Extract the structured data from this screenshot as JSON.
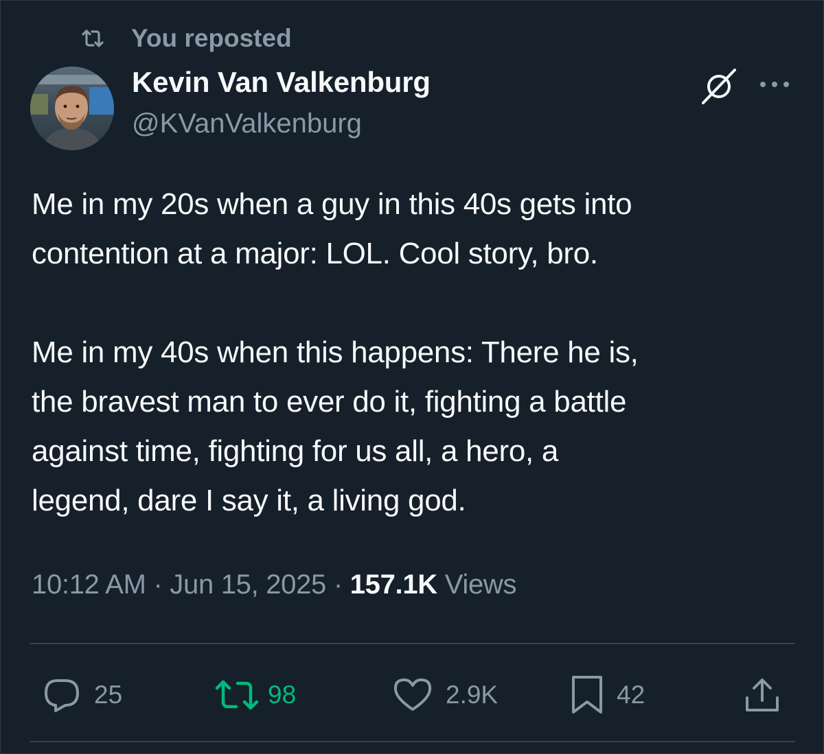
{
  "repost_banner": {
    "label": "You reposted",
    "icon": "repost-icon"
  },
  "author": {
    "display_name": "Kevin Van Valkenburg",
    "handle": "@KVanValkenburg"
  },
  "header_icons": [
    "grok-icon",
    "more-icon"
  ],
  "tweet": {
    "text": "Me in my 20s when a guy in this 40s gets into\ncontention at a major: LOL. Cool story, bro.\n\nMe in my 40s when this happens: There he is,\nthe bravest man to ever do it, fighting a battle\nagainst time, fighting for us all, a hero, a\nlegend, dare I say it, a living god."
  },
  "meta": {
    "time": "10:12 AM",
    "separator": "·",
    "date": "Jun 15, 2025",
    "views_count": "157.1K",
    "views_label": "Views"
  },
  "actions": {
    "reply": {
      "icon": "reply-icon",
      "count": "25"
    },
    "repost": {
      "icon": "repost-icon",
      "count": "98",
      "active": true
    },
    "like": {
      "icon": "heart-icon",
      "count": "2.9K"
    },
    "bookmark": {
      "icon": "bookmark-icon",
      "count": "42"
    },
    "share": {
      "icon": "share-icon"
    }
  },
  "colors": {
    "background": "#15202b",
    "text_primary": "#f7f9f9",
    "text_secondary": "#8b98a5",
    "divider": "#38444d",
    "repost_active": "#00ba7c"
  }
}
